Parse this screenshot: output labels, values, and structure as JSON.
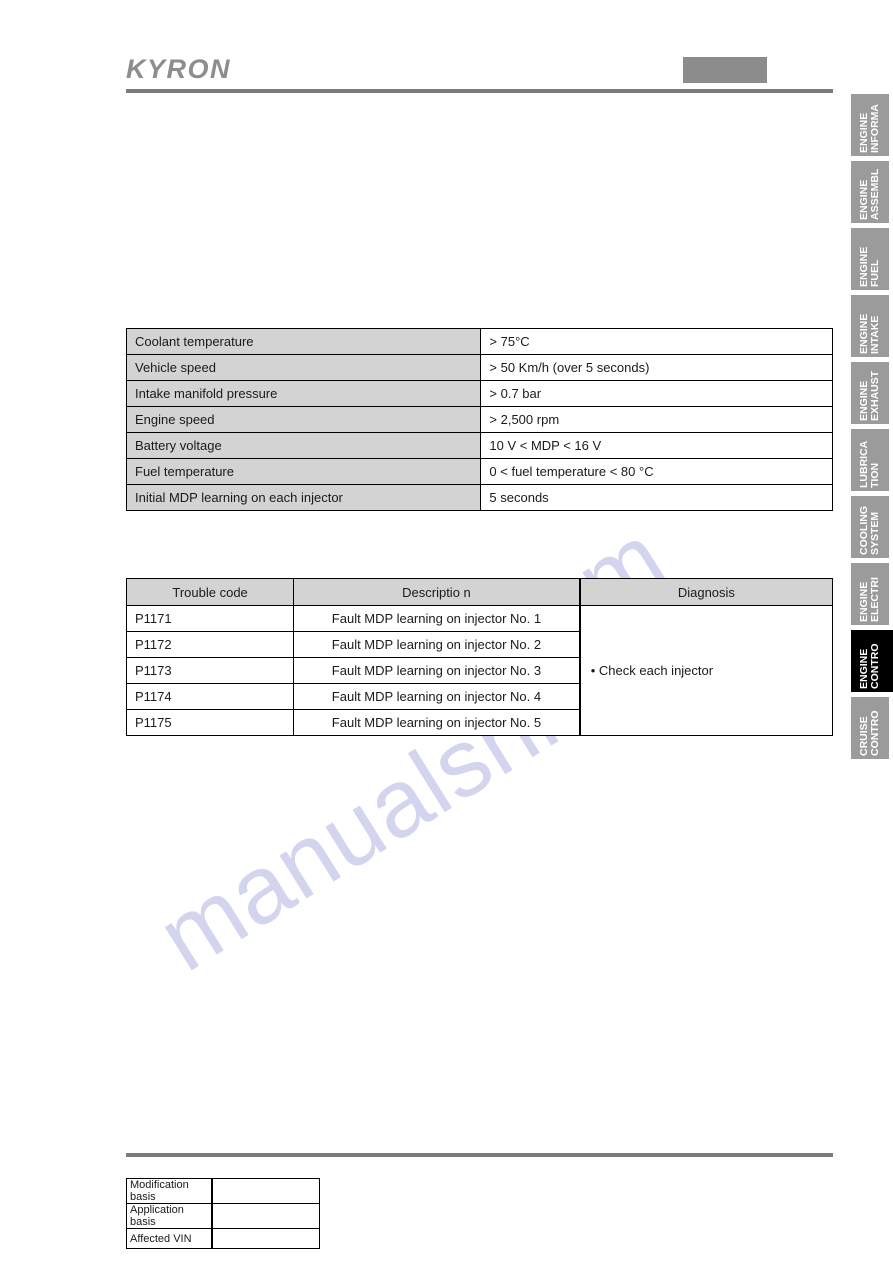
{
  "header": {
    "brand": "KYRON",
    "corner_box_label": ""
  },
  "side_tabs": [
    {
      "line1": "ENGINE",
      "line2": "INFORMA",
      "active": false
    },
    {
      "line1": "ENGINE",
      "line2": "ASSEMBL",
      "active": false
    },
    {
      "line1": "ENGINE",
      "line2": "FUEL",
      "active": false
    },
    {
      "line1": "ENGINE",
      "line2": "INTAKE",
      "active": false
    },
    {
      "line1": "ENGINE",
      "line2": "EXHAUST",
      "active": false
    },
    {
      "line1": "LUBRICA",
      "line2": "TION",
      "active": false
    },
    {
      "line1": "COOLING",
      "line2": "SYSTEM",
      "active": false
    },
    {
      "line1": "ENGINE",
      "line2": "ELECTRI",
      "active": false
    },
    {
      "line1": "ENGINE",
      "line2": "CONTRO",
      "active": true
    },
    {
      "line1": "CRUISE",
      "line2": "CONTRO",
      "active": false
    }
  ],
  "conditions_table": {
    "rows": [
      {
        "label": "Coolant temperature",
        "value": "> 75°C"
      },
      {
        "label": "Vehicle speed",
        "value": "> 50 Km/h (over 5 seconds)"
      },
      {
        "label": "Intake manifold pressure",
        "value": "> 0.7 bar"
      },
      {
        "label": "Engine speed",
        "value": "> 2,500 rpm"
      },
      {
        "label": "Battery voltage",
        "value": "10 V < MDP < 16 V"
      },
      {
        "label": "Fuel temperature",
        "value": "0 < fuel temperature < 80 °C"
      },
      {
        "label": "Initial MDP learning on each injector",
        "value": "5 seconds"
      }
    ]
  },
  "codes_table": {
    "headers": {
      "code": "Trouble  code",
      "description": "Descriptio n",
      "diagnosis": "Diagnosis"
    },
    "rows": [
      {
        "code": "P1171",
        "description": "Fault MDP learning on injector No. 1"
      },
      {
        "code": "P1172",
        "description": "Fault MDP learning on injector No. 2"
      },
      {
        "code": "P1173",
        "description": "Fault MDP learning on injector No. 3"
      },
      {
        "code": "P1174",
        "description": "Fault MDP learning on injector No. 4"
      },
      {
        "code": "P1175",
        "description": "Fault MDP learning on injector No. 5"
      }
    ],
    "diagnosis_value": "• Check each injector"
  },
  "revision_table": {
    "rows": [
      {
        "label": "Modification basis",
        "value": ""
      },
      {
        "label": "Application basis",
        "value": ""
      },
      {
        "label": "Affected VIN",
        "value": ""
      }
    ]
  },
  "watermark": {
    "text_a": "manualshive.",
    "text_b": "com"
  },
  "colors": {
    "rule": "#7b7b7b",
    "tab_inactive": "#9b9b9b",
    "tab_active": "#000000",
    "table_header_gray": "#d3d3d3",
    "brand_gray": "#8d8d8d",
    "watermark": "#b9bbe4"
  }
}
